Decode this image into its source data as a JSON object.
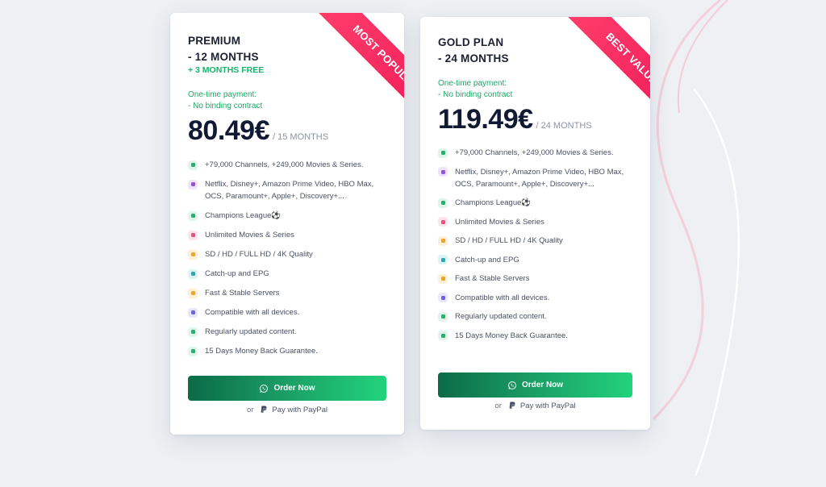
{
  "plans": [
    {
      "name": "PREMIUM\n- 12 MONTHS",
      "bonus": "+ 3 MONTHS FREE",
      "payment_line1": "One-time payment:",
      "payment_line2": "- No binding contract",
      "price": "80.49€",
      "period": "/ 15 MONTHS",
      "ribbon": "MOST POPULAR",
      "features": [
        "+79,000 Channels, +249,000 Movies & Series.",
        "Netflix, Disney+, Amazon Prime Video, HBO Max, OCS, Paramount+, Apple+, Discovery+...",
        "Champions League⚽",
        "Unlimited Movies & Series",
        "SD / HD / FULL HD / 4K Quality",
        "Catch-up and EPG",
        "Fast & Stable Servers",
        "Compatible with all devices.",
        "Regularly updated content.",
        "15 Days Money Back Guarantee."
      ],
      "order_label": "Order Now",
      "or_text": "or",
      "paypal_label": "Pay with PayPal"
    },
    {
      "name": "GOLD PLAN\n- 24 MONTHS",
      "payment_line1": "One-time payment:",
      "payment_line2": "- No binding contract",
      "price": "119.49€",
      "period": "/ 24 MONTHS",
      "ribbon": "BEST VALUE",
      "features": [
        "+79,000 Channels, +249,000 Movies & Series.",
        "Netflix, Disney+, Amazon Prime Video, HBO Max, OCS, Paramount+, Apple+, Discovery+...",
        "Champions League⚽",
        "Unlimited Movies & Series",
        "SD / HD / FULL HD / 4K Quality",
        "Catch-up and EPG",
        "Fast & Stable Servers",
        "Compatible with all devices.",
        "Regularly updated content.",
        "15 Days Money Back Guarantee."
      ],
      "order_label": "Order Now",
      "or_text": "or",
      "paypal_label": "Pay with PayPal"
    }
  ],
  "feature_icons": [
    {
      "name": "tv-icon",
      "bg": "#dff5ea",
      "fg": "#1fb36e"
    },
    {
      "name": "film-icon",
      "bg": "#efe3fb",
      "fg": "#9b4fe0"
    },
    {
      "name": "soccer-ball-icon",
      "bg": "#dff5ea",
      "fg": "#1fb36e"
    },
    {
      "name": "video-camera-icon",
      "bg": "#fde3ea",
      "fg": "#ef4f7c"
    },
    {
      "name": "quality-icon",
      "bg": "#fdf0d6",
      "fg": "#f0a51c"
    },
    {
      "name": "clock-icon",
      "bg": "#dcf2f4",
      "fg": "#26a8b8"
    },
    {
      "name": "server-icon",
      "bg": "#fdf0d6",
      "fg": "#f0a51c"
    },
    {
      "name": "monitor-icon",
      "bg": "#e7e6fb",
      "fg": "#6b63e6"
    },
    {
      "name": "refresh-icon",
      "bg": "#dff5ea",
      "fg": "#1fb36e"
    },
    {
      "name": "shield-check-icon",
      "bg": "#dff5ea",
      "fg": "#1fb36e"
    }
  ],
  "colors": {
    "accent_green": "#19b26b",
    "ribbon_pink": "#ef1f5c",
    "price_text": "#121a33"
  }
}
